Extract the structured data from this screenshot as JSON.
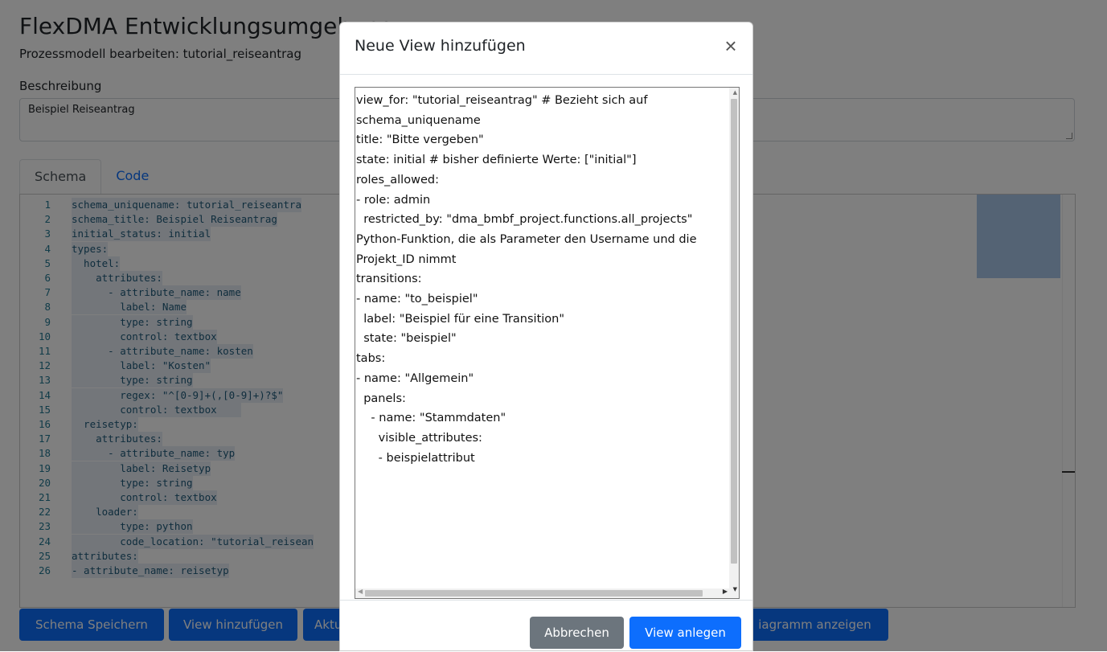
{
  "app": {
    "title": "FlexDMA Entwicklungsumgebung",
    "subtitle": "Prozessmodell bearbeiten: tutorial_reiseantrag"
  },
  "description": {
    "label": "Beschreibung",
    "value": "Beispiel Reiseantrag"
  },
  "tabs": [
    {
      "label": "Schema",
      "active": true
    },
    {
      "label": "Code",
      "active": false
    }
  ],
  "editor": {
    "lines": [
      {
        "num": "1",
        "text": "schema_uniquename: tutorial_reiseantra"
      },
      {
        "num": "2",
        "text": "schema_title: Beispiel Reiseantrag"
      },
      {
        "num": "3",
        "text": "initial_status: initial"
      },
      {
        "num": "4",
        "text": "types:"
      },
      {
        "num": "5",
        "text": "  hotel:"
      },
      {
        "num": "6",
        "text": "    attributes:"
      },
      {
        "num": "7",
        "text": "      - attribute_name: name"
      },
      {
        "num": "8",
        "text": "        label: Name"
      },
      {
        "num": "9",
        "text": "        type: string"
      },
      {
        "num": "10",
        "text": "        control: textbox"
      },
      {
        "num": "11",
        "text": "      - attribute_name: kosten"
      },
      {
        "num": "12",
        "text": "        label: \"Kosten\""
      },
      {
        "num": "13",
        "text": "        type: string"
      },
      {
        "num": "14",
        "text": "        regex: \"^[0-9]+(,[0-9]+)?$\""
      },
      {
        "num": "15",
        "text": "        control: textbox    "
      },
      {
        "num": "16",
        "text": "  reisetyp:"
      },
      {
        "num": "17",
        "text": "    attributes:"
      },
      {
        "num": "18",
        "text": "      - attribute_name: typ"
      },
      {
        "num": "19",
        "text": "        label: Reisetyp"
      },
      {
        "num": "20",
        "text": "        type: string"
      },
      {
        "num": "21",
        "text": "        control: textbox"
      },
      {
        "num": "22",
        "text": "    loader:"
      },
      {
        "num": "23",
        "text": "        type: python"
      },
      {
        "num": "24",
        "text": "        code_location: \"tutorial_reisean"
      },
      {
        "num": "25",
        "text": "attributes:"
      },
      {
        "num": "26",
        "text": "- attribute_name: reisetyp"
      }
    ]
  },
  "actions": {
    "schema_save": "Schema Speichern",
    "add_view": "View hinzufügen",
    "update_partial": "Aktu",
    "diagram_partial": "iagramm anzeigen"
  },
  "modal": {
    "title": "Neue View hinzufügen",
    "close_symbol": "×",
    "textarea_lines": [
      "view_for: \"tutorial_reiseantrag\" # Bezieht sich auf",
      "schema_uniquename",
      "title: \"Bitte vergeben\"",
      "state: initial # bisher definierte Werte: [\"initial\"]",
      "roles_allowed:",
      "- role: admin",
      "  restricted_by: \"dma_bmbf_project.functions.all_projects\"",
      "Python-Funktion, die als Parameter den Username und die",
      "Projekt_ID nimmt",
      "transitions:",
      "- name: \"to_beispiel\"",
      "  label: \"Beispiel für eine Transition\"",
      "  state: \"beispiel\"",
      "tabs:",
      "- name: \"Allgemein\"",
      "  panels:",
      "    - name: \"Stammdaten\"",
      "      visible_attributes:",
      "      - beispielattribut"
    ],
    "cancel_label": "Abbrechen",
    "create_label": "View anlegen"
  },
  "colors": {
    "primary": "#0d6efd",
    "secondary": "#6c757d",
    "backdrop": "rgba(0,0,0,0.5)"
  }
}
